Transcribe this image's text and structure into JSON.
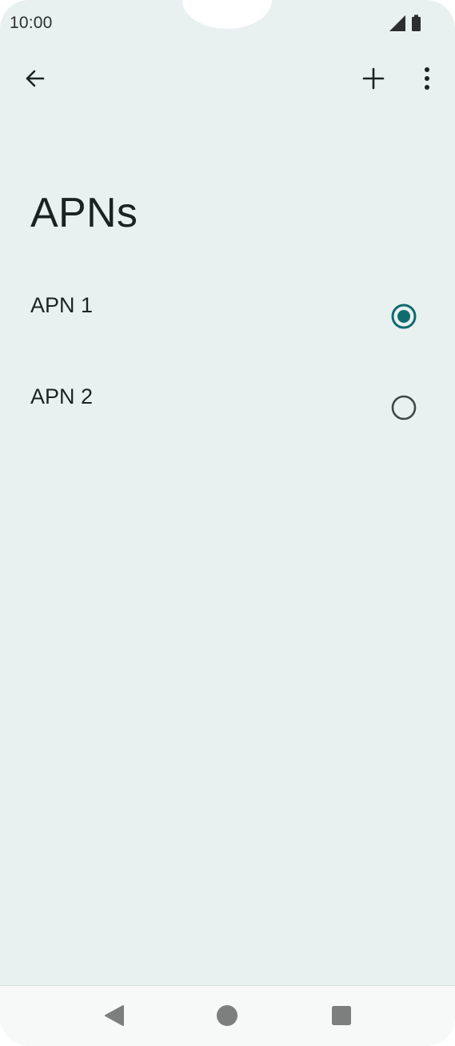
{
  "status_bar": {
    "time": "10:00",
    "icons": [
      "signal-icon",
      "battery-icon"
    ]
  },
  "top_bar": {
    "back_icon": "arrow-left-icon",
    "add_icon": "plus-icon",
    "more_icon": "more-vertical-icon"
  },
  "page": {
    "title": "APNs"
  },
  "apns": [
    {
      "label": "APN 1",
      "selected": true
    },
    {
      "label": "APN 2",
      "selected": false
    }
  ],
  "nav_bar": {
    "back_icon": "nav-back-triangle-icon",
    "home_icon": "nav-home-circle-icon",
    "recents_icon": "nav-recents-square-icon"
  },
  "colors": {
    "background": "#e9f1f0",
    "radio_selected": "#0f6b6e",
    "radio_unselected": "#3f4948",
    "text_primary": "#1d2322"
  }
}
